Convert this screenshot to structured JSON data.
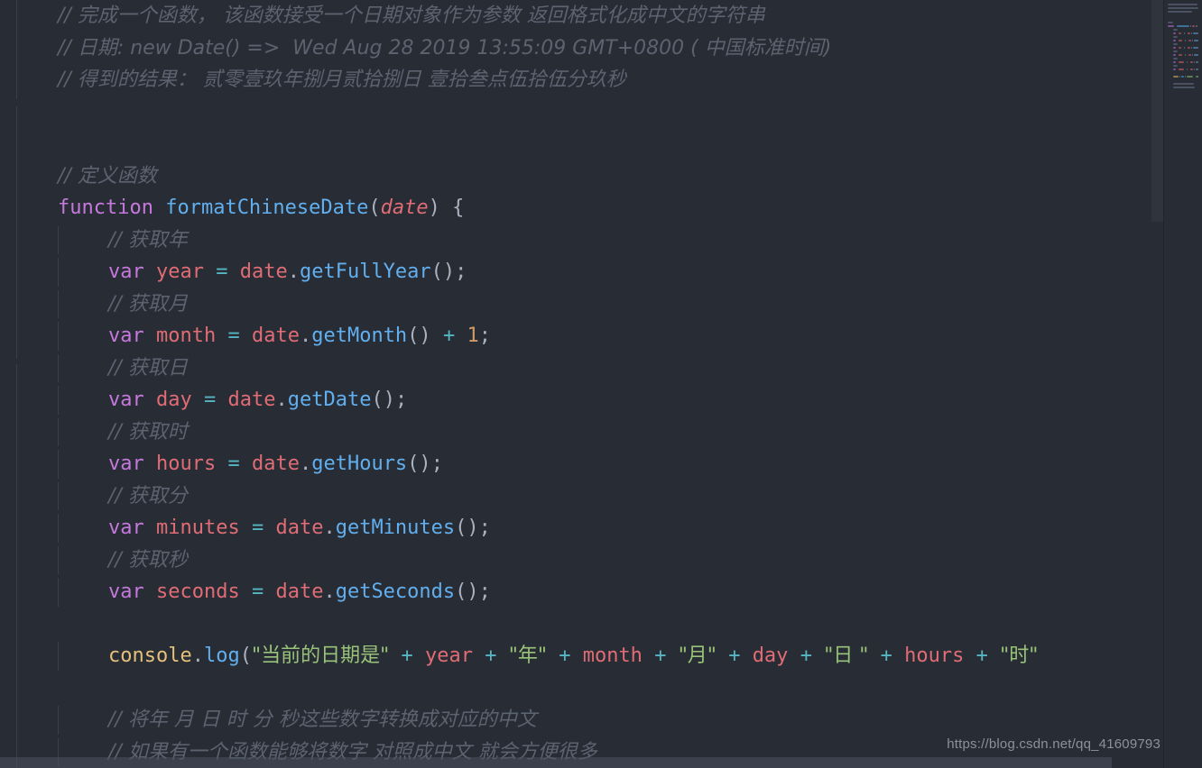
{
  "editor": {
    "theme_background": "#282c34",
    "language": "javascript",
    "font_size_px": 22,
    "line_height_px": 35.5
  },
  "colors": {
    "background": "#282c34",
    "comment": "#5c6370",
    "keyword": "#c678dd",
    "function": "#61afef",
    "variable": "#e06c75",
    "operator": "#56b6c2",
    "punctuation": "#abb2bf",
    "number": "#d19a66",
    "string": "#98c379",
    "object": "#e5c07b",
    "indent_guide": "#3b4048",
    "scrollbar": "#4b5261"
  },
  "code": {
    "lines": [
      {
        "indent": 0,
        "tokens": [
          {
            "t": "comment",
            "v": "// 完成一个函数， 该函数接受一个日期对象作为参数 返回格式化成中文的字符串"
          }
        ]
      },
      {
        "indent": 0,
        "tokens": [
          {
            "t": "comment",
            "v": "// 日期: new Date() =>  Wed Aug 28 2019 13:55:09 GMT+0800 ( 中国标准时间)"
          }
        ]
      },
      {
        "indent": 0,
        "tokens": [
          {
            "t": "comment",
            "v": "// 得到的结果： 贰零壹玖年捌月贰拾捌日 壹拾叁点伍拾伍分玖秒"
          }
        ]
      },
      {
        "indent": 0,
        "tokens": []
      },
      {
        "indent": 0,
        "tokens": []
      },
      {
        "indent": 0,
        "tokens": [
          {
            "t": "comment",
            "v": "// 定义函数"
          }
        ]
      },
      {
        "indent": 0,
        "tokens": [
          {
            "t": "keyword",
            "v": "function"
          },
          {
            "t": "plain",
            "v": " "
          },
          {
            "t": "function",
            "v": "formatChineseDate"
          },
          {
            "t": "punctuation",
            "v": "("
          },
          {
            "t": "param",
            "v": "date"
          },
          {
            "t": "punctuation",
            "v": ")"
          },
          {
            "t": "plain",
            "v": " "
          },
          {
            "t": "punctuation",
            "v": "{"
          }
        ]
      },
      {
        "indent": 1,
        "tokens": [
          {
            "t": "comment",
            "v": "// 获取年"
          }
        ]
      },
      {
        "indent": 1,
        "tokens": [
          {
            "t": "keyword",
            "v": "var"
          },
          {
            "t": "plain",
            "v": " "
          },
          {
            "t": "variable",
            "v": "year"
          },
          {
            "t": "plain",
            "v": " "
          },
          {
            "t": "operator",
            "v": "="
          },
          {
            "t": "plain",
            "v": " "
          },
          {
            "t": "variable",
            "v": "date"
          },
          {
            "t": "punctuation",
            "v": "."
          },
          {
            "t": "function",
            "v": "getFullYear"
          },
          {
            "t": "punctuation",
            "v": "()"
          },
          {
            "t": "punctuation",
            "v": ";"
          }
        ]
      },
      {
        "indent": 1,
        "tokens": [
          {
            "t": "comment",
            "v": "// 获取月"
          }
        ]
      },
      {
        "indent": 1,
        "tokens": [
          {
            "t": "keyword",
            "v": "var"
          },
          {
            "t": "plain",
            "v": " "
          },
          {
            "t": "variable",
            "v": "month"
          },
          {
            "t": "plain",
            "v": " "
          },
          {
            "t": "operator",
            "v": "="
          },
          {
            "t": "plain",
            "v": " "
          },
          {
            "t": "variable",
            "v": "date"
          },
          {
            "t": "punctuation",
            "v": "."
          },
          {
            "t": "function",
            "v": "getMonth"
          },
          {
            "t": "punctuation",
            "v": "()"
          },
          {
            "t": "plain",
            "v": " "
          },
          {
            "t": "operator",
            "v": "+"
          },
          {
            "t": "plain",
            "v": " "
          },
          {
            "t": "number",
            "v": "1"
          },
          {
            "t": "punctuation",
            "v": ";"
          }
        ]
      },
      {
        "indent": 1,
        "tokens": [
          {
            "t": "comment",
            "v": "// 获取日"
          }
        ]
      },
      {
        "indent": 1,
        "tokens": [
          {
            "t": "keyword",
            "v": "var"
          },
          {
            "t": "plain",
            "v": " "
          },
          {
            "t": "variable",
            "v": "day"
          },
          {
            "t": "plain",
            "v": " "
          },
          {
            "t": "operator",
            "v": "="
          },
          {
            "t": "plain",
            "v": " "
          },
          {
            "t": "variable",
            "v": "date"
          },
          {
            "t": "punctuation",
            "v": "."
          },
          {
            "t": "function",
            "v": "getDate"
          },
          {
            "t": "punctuation",
            "v": "()"
          },
          {
            "t": "punctuation",
            "v": ";"
          }
        ]
      },
      {
        "indent": 1,
        "tokens": [
          {
            "t": "comment",
            "v": "// 获取时"
          }
        ]
      },
      {
        "indent": 1,
        "tokens": [
          {
            "t": "keyword",
            "v": "var"
          },
          {
            "t": "plain",
            "v": " "
          },
          {
            "t": "variable",
            "v": "hours"
          },
          {
            "t": "plain",
            "v": " "
          },
          {
            "t": "operator",
            "v": "="
          },
          {
            "t": "plain",
            "v": " "
          },
          {
            "t": "variable",
            "v": "date"
          },
          {
            "t": "punctuation",
            "v": "."
          },
          {
            "t": "function",
            "v": "getHours"
          },
          {
            "t": "punctuation",
            "v": "()"
          },
          {
            "t": "punctuation",
            "v": ";"
          }
        ]
      },
      {
        "indent": 1,
        "tokens": [
          {
            "t": "comment",
            "v": "// 获取分"
          }
        ]
      },
      {
        "indent": 1,
        "tokens": [
          {
            "t": "keyword",
            "v": "var"
          },
          {
            "t": "plain",
            "v": " "
          },
          {
            "t": "variable",
            "v": "minutes"
          },
          {
            "t": "plain",
            "v": " "
          },
          {
            "t": "operator",
            "v": "="
          },
          {
            "t": "plain",
            "v": " "
          },
          {
            "t": "variable",
            "v": "date"
          },
          {
            "t": "punctuation",
            "v": "."
          },
          {
            "t": "function",
            "v": "getMinutes"
          },
          {
            "t": "punctuation",
            "v": "()"
          },
          {
            "t": "punctuation",
            "v": ";"
          }
        ]
      },
      {
        "indent": 1,
        "tokens": [
          {
            "t": "comment",
            "v": "// 获取秒"
          }
        ]
      },
      {
        "indent": 1,
        "tokens": [
          {
            "t": "keyword",
            "v": "var"
          },
          {
            "t": "plain",
            "v": " "
          },
          {
            "t": "variable",
            "v": "seconds"
          },
          {
            "t": "plain",
            "v": " "
          },
          {
            "t": "operator",
            "v": "="
          },
          {
            "t": "plain",
            "v": " "
          },
          {
            "t": "variable",
            "v": "date"
          },
          {
            "t": "punctuation",
            "v": "."
          },
          {
            "t": "function",
            "v": "getSeconds"
          },
          {
            "t": "punctuation",
            "v": "()"
          },
          {
            "t": "punctuation",
            "v": ";"
          }
        ]
      },
      {
        "indent": 0,
        "tokens": []
      },
      {
        "indent": 1,
        "tokens": [
          {
            "t": "object",
            "v": "console"
          },
          {
            "t": "punctuation",
            "v": "."
          },
          {
            "t": "function",
            "v": "log"
          },
          {
            "t": "punctuation",
            "v": "("
          },
          {
            "t": "string",
            "v": "\"当前的日期是\""
          },
          {
            "t": "plain",
            "v": " "
          },
          {
            "t": "operator",
            "v": "+"
          },
          {
            "t": "plain",
            "v": " "
          },
          {
            "t": "variable",
            "v": "year"
          },
          {
            "t": "plain",
            "v": " "
          },
          {
            "t": "operator",
            "v": "+"
          },
          {
            "t": "plain",
            "v": " "
          },
          {
            "t": "string",
            "v": "\"年\""
          },
          {
            "t": "plain",
            "v": " "
          },
          {
            "t": "operator",
            "v": "+"
          },
          {
            "t": "plain",
            "v": " "
          },
          {
            "t": "variable",
            "v": "month"
          },
          {
            "t": "plain",
            "v": " "
          },
          {
            "t": "operator",
            "v": "+"
          },
          {
            "t": "plain",
            "v": " "
          },
          {
            "t": "string",
            "v": "\"月\""
          },
          {
            "t": "plain",
            "v": " "
          },
          {
            "t": "operator",
            "v": "+"
          },
          {
            "t": "plain",
            "v": " "
          },
          {
            "t": "variable",
            "v": "day"
          },
          {
            "t": "plain",
            "v": " "
          },
          {
            "t": "operator",
            "v": "+"
          },
          {
            "t": "plain",
            "v": " "
          },
          {
            "t": "string",
            "v": "\"日 \""
          },
          {
            "t": "plain",
            "v": " "
          },
          {
            "t": "operator",
            "v": "+"
          },
          {
            "t": "plain",
            "v": " "
          },
          {
            "t": "variable",
            "v": "hours"
          },
          {
            "t": "plain",
            "v": " "
          },
          {
            "t": "operator",
            "v": "+"
          },
          {
            "t": "plain",
            "v": " "
          },
          {
            "t": "string",
            "v": "\"时\""
          }
        ]
      },
      {
        "indent": 0,
        "tokens": []
      },
      {
        "indent": 1,
        "tokens": [
          {
            "t": "comment",
            "v": "// 将年 月 日 时 分 秒这些数字转换成对应的中文"
          }
        ]
      },
      {
        "indent": 1,
        "tokens": [
          {
            "t": "comment",
            "v": "// 如果有一个函数能够将数字 对照成中文 就会方便很多"
          }
        ]
      }
    ]
  },
  "watermark": {
    "text": "https://blog.csdn.net/qq_41609793"
  },
  "minimap": {
    "present": true
  },
  "scrollbars": {
    "horizontal_present": true,
    "vertical_present": true
  }
}
